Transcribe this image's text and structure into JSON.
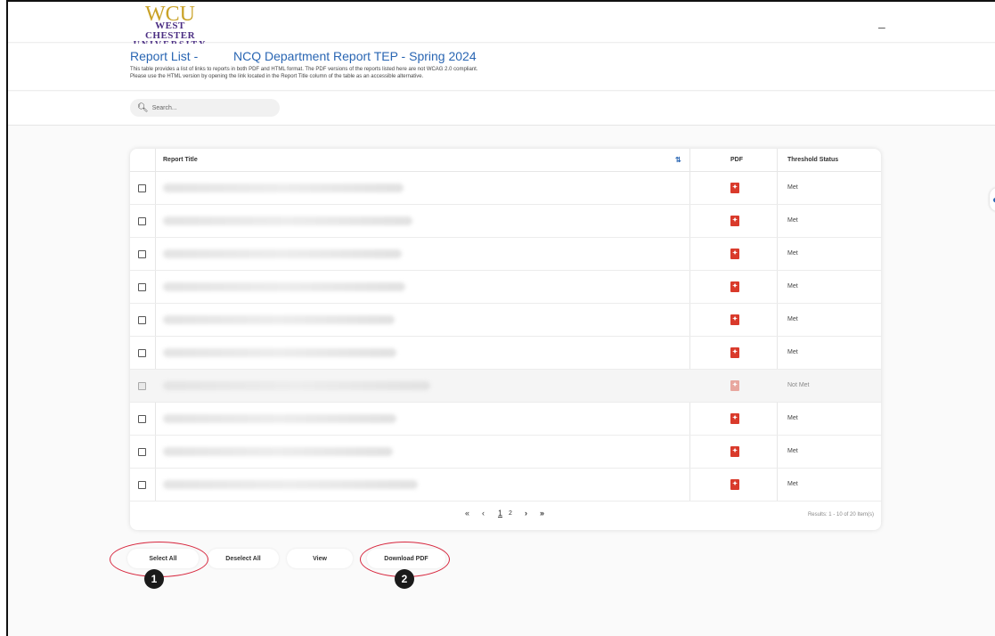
{
  "logo": {
    "line1": "WCU",
    "line2": "WEST CHESTER",
    "line3": "UNIVERSITY"
  },
  "window": {
    "minimize": "–"
  },
  "header": {
    "report_list": "Report List -",
    "report_name": "NCQ Department Report TEP - Spring 2024",
    "desc_line1": "This table provides a list of links to reports in both PDF and HTML format. The PDF versions of the reports listed here are not WCAG 2.0 compliant.",
    "desc_line2": "Please use the HTML version by opening the link located in the Report Title column of the table as an accessible alternative."
  },
  "search": {
    "placeholder": "Search..."
  },
  "table": {
    "columns": {
      "title": "Report Title",
      "pdf": "PDF",
      "status": "Threshold Status"
    },
    "rows": [
      {
        "status": "Met",
        "disabled": false
      },
      {
        "status": "Met",
        "disabled": false
      },
      {
        "status": "Met",
        "disabled": false
      },
      {
        "status": "Met",
        "disabled": false
      },
      {
        "status": "Met",
        "disabled": false
      },
      {
        "status": "Met",
        "disabled": false
      },
      {
        "status": "Not Met",
        "disabled": true
      },
      {
        "status": "Met",
        "disabled": false
      },
      {
        "status": "Met",
        "disabled": false
      },
      {
        "status": "Met",
        "disabled": false
      }
    ]
  },
  "pager": {
    "first": "«",
    "prev": "‹",
    "page1": "1",
    "page2": "2",
    "next": "›",
    "last": "»",
    "results": "Results: 1 - 10 of 20 Item(s)"
  },
  "buttons": {
    "select_all": "Select All",
    "deselect_all": "Deselect All",
    "view": "View",
    "download_pdf": "Download PDF"
  },
  "annotations": {
    "badge1": "1",
    "badge2": "2"
  },
  "colors": {
    "accent": "#2a66b3",
    "pdf_red": "#d93a2b",
    "annotation_red": "#d7263d",
    "gold": "#c9a227",
    "purple": "#4b2e83"
  }
}
